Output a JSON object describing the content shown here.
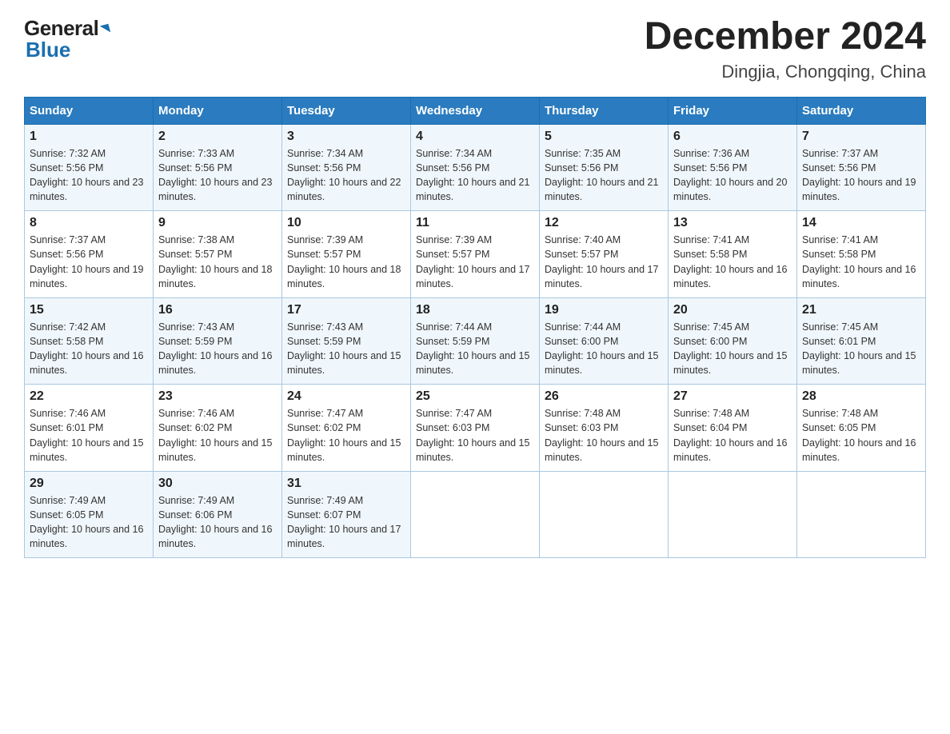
{
  "header": {
    "month_year": "December 2024",
    "location": "Dingjia, Chongqing, China",
    "logo_line1": "General",
    "logo_line2": "Blue"
  },
  "columns": [
    "Sunday",
    "Monday",
    "Tuesday",
    "Wednesday",
    "Thursday",
    "Friday",
    "Saturday"
  ],
  "weeks": [
    [
      {
        "day": "1",
        "sunrise": "7:32 AM",
        "sunset": "5:56 PM",
        "daylight": "10 hours and 23 minutes."
      },
      {
        "day": "2",
        "sunrise": "7:33 AM",
        "sunset": "5:56 PM",
        "daylight": "10 hours and 23 minutes."
      },
      {
        "day": "3",
        "sunrise": "7:34 AM",
        "sunset": "5:56 PM",
        "daylight": "10 hours and 22 minutes."
      },
      {
        "day": "4",
        "sunrise": "7:34 AM",
        "sunset": "5:56 PM",
        "daylight": "10 hours and 21 minutes."
      },
      {
        "day": "5",
        "sunrise": "7:35 AM",
        "sunset": "5:56 PM",
        "daylight": "10 hours and 21 minutes."
      },
      {
        "day": "6",
        "sunrise": "7:36 AM",
        "sunset": "5:56 PM",
        "daylight": "10 hours and 20 minutes."
      },
      {
        "day": "7",
        "sunrise": "7:37 AM",
        "sunset": "5:56 PM",
        "daylight": "10 hours and 19 minutes."
      }
    ],
    [
      {
        "day": "8",
        "sunrise": "7:37 AM",
        "sunset": "5:56 PM",
        "daylight": "10 hours and 19 minutes."
      },
      {
        "day": "9",
        "sunrise": "7:38 AM",
        "sunset": "5:57 PM",
        "daylight": "10 hours and 18 minutes."
      },
      {
        "day": "10",
        "sunrise": "7:39 AM",
        "sunset": "5:57 PM",
        "daylight": "10 hours and 18 minutes."
      },
      {
        "day": "11",
        "sunrise": "7:39 AM",
        "sunset": "5:57 PM",
        "daylight": "10 hours and 17 minutes."
      },
      {
        "day": "12",
        "sunrise": "7:40 AM",
        "sunset": "5:57 PM",
        "daylight": "10 hours and 17 minutes."
      },
      {
        "day": "13",
        "sunrise": "7:41 AM",
        "sunset": "5:58 PM",
        "daylight": "10 hours and 16 minutes."
      },
      {
        "day": "14",
        "sunrise": "7:41 AM",
        "sunset": "5:58 PM",
        "daylight": "10 hours and 16 minutes."
      }
    ],
    [
      {
        "day": "15",
        "sunrise": "7:42 AM",
        "sunset": "5:58 PM",
        "daylight": "10 hours and 16 minutes."
      },
      {
        "day": "16",
        "sunrise": "7:43 AM",
        "sunset": "5:59 PM",
        "daylight": "10 hours and 16 minutes."
      },
      {
        "day": "17",
        "sunrise": "7:43 AM",
        "sunset": "5:59 PM",
        "daylight": "10 hours and 15 minutes."
      },
      {
        "day": "18",
        "sunrise": "7:44 AM",
        "sunset": "5:59 PM",
        "daylight": "10 hours and 15 minutes."
      },
      {
        "day": "19",
        "sunrise": "7:44 AM",
        "sunset": "6:00 PM",
        "daylight": "10 hours and 15 minutes."
      },
      {
        "day": "20",
        "sunrise": "7:45 AM",
        "sunset": "6:00 PM",
        "daylight": "10 hours and 15 minutes."
      },
      {
        "day": "21",
        "sunrise": "7:45 AM",
        "sunset": "6:01 PM",
        "daylight": "10 hours and 15 minutes."
      }
    ],
    [
      {
        "day": "22",
        "sunrise": "7:46 AM",
        "sunset": "6:01 PM",
        "daylight": "10 hours and 15 minutes."
      },
      {
        "day": "23",
        "sunrise": "7:46 AM",
        "sunset": "6:02 PM",
        "daylight": "10 hours and 15 minutes."
      },
      {
        "day": "24",
        "sunrise": "7:47 AM",
        "sunset": "6:02 PM",
        "daylight": "10 hours and 15 minutes."
      },
      {
        "day": "25",
        "sunrise": "7:47 AM",
        "sunset": "6:03 PM",
        "daylight": "10 hours and 15 minutes."
      },
      {
        "day": "26",
        "sunrise": "7:48 AM",
        "sunset": "6:03 PM",
        "daylight": "10 hours and 15 minutes."
      },
      {
        "day": "27",
        "sunrise": "7:48 AM",
        "sunset": "6:04 PM",
        "daylight": "10 hours and 16 minutes."
      },
      {
        "day": "28",
        "sunrise": "7:48 AM",
        "sunset": "6:05 PM",
        "daylight": "10 hours and 16 minutes."
      }
    ],
    [
      {
        "day": "29",
        "sunrise": "7:49 AM",
        "sunset": "6:05 PM",
        "daylight": "10 hours and 16 minutes."
      },
      {
        "day": "30",
        "sunrise": "7:49 AM",
        "sunset": "6:06 PM",
        "daylight": "10 hours and 16 minutes."
      },
      {
        "day": "31",
        "sunrise": "7:49 AM",
        "sunset": "6:07 PM",
        "daylight": "10 hours and 17 minutes."
      },
      null,
      null,
      null,
      null
    ]
  ],
  "labels": {
    "sunrise": "Sunrise:",
    "sunset": "Sunset:",
    "daylight": "Daylight:"
  }
}
